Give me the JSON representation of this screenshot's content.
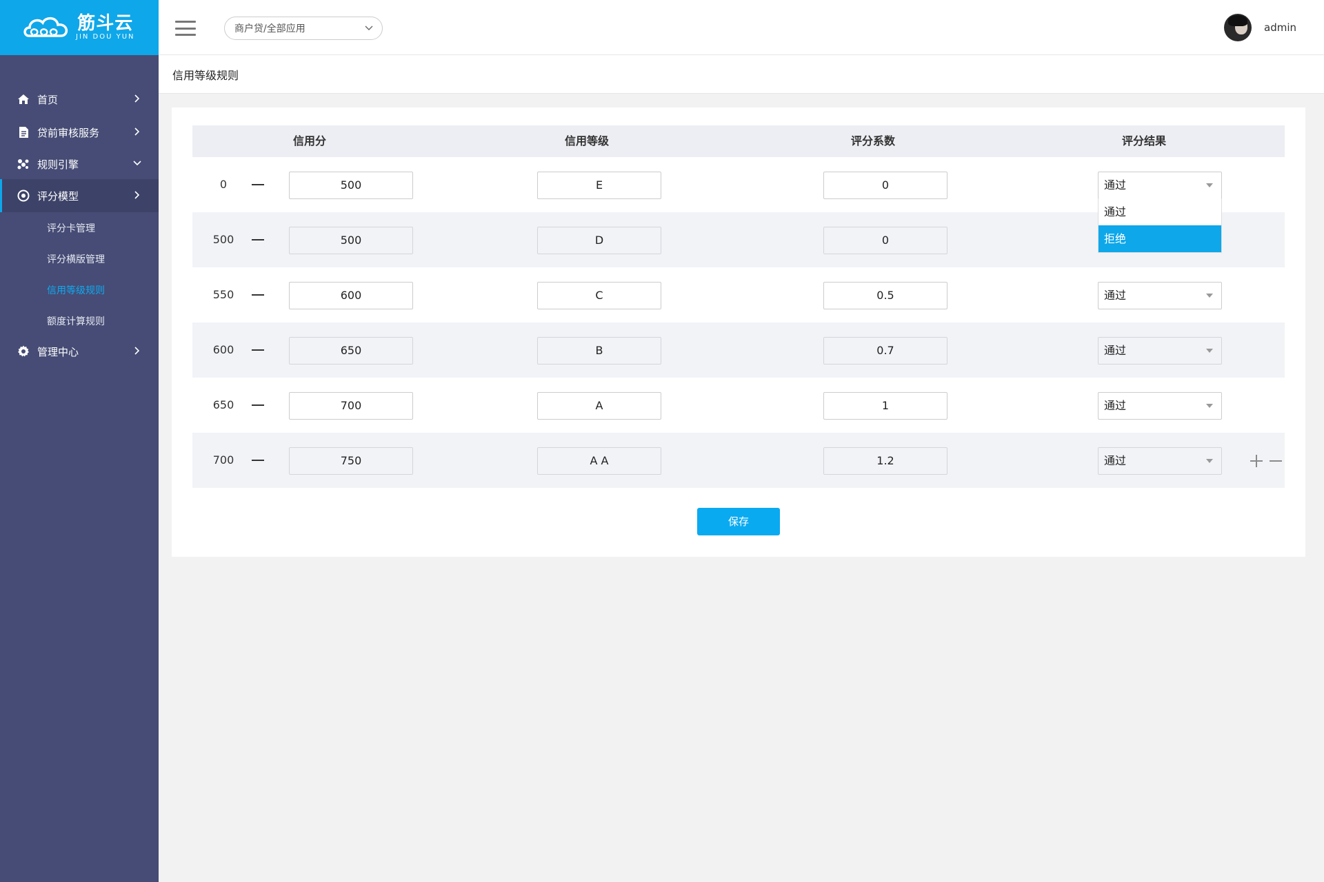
{
  "logo": {
    "cn": "筋斗云",
    "en": "JIN DOU YUN"
  },
  "sidebar": {
    "items": [
      {
        "label": "首页",
        "icon": "home-icon"
      },
      {
        "label": "贷前审核服务",
        "icon": "document-icon"
      },
      {
        "label": "规则引擎",
        "icon": "rules-engine-icon"
      },
      {
        "label": "评分模型",
        "icon": "target-icon"
      }
    ],
    "sub_items": [
      {
        "label": "评分卡管理"
      },
      {
        "label": "评分横版管理"
      },
      {
        "label": "信用等级规则"
      },
      {
        "label": "额度计算规则"
      }
    ],
    "admin_item": {
      "label": "管理中心",
      "icon": "gear-icon"
    }
  },
  "header": {
    "app_select": "商户贷/全部应用",
    "username": "admin"
  },
  "page": {
    "title": "信用等级规则"
  },
  "table": {
    "headers": [
      "信用分",
      "信用等级",
      "评分系数",
      "评分结果"
    ],
    "rows": [
      {
        "lo": "0",
        "hi": "500",
        "grade": "E",
        "coef": "0",
        "result": "通过"
      },
      {
        "lo": "500",
        "hi": "500",
        "grade": "D",
        "coef": "0",
        "result": "通过"
      },
      {
        "lo": "550",
        "hi": "600",
        "grade": "C",
        "coef": "0.5",
        "result": "通过"
      },
      {
        "lo": "600",
        "hi": "650",
        "grade": "B",
        "coef": "0.7",
        "result": "通过"
      },
      {
        "lo": "650",
        "hi": "700",
        "grade": "A",
        "coef": "1",
        "result": "通过"
      },
      {
        "lo": "700",
        "hi": "750",
        "grade": "A A",
        "coef": "1.2",
        "result": "通过"
      }
    ]
  },
  "dropdown": {
    "options": [
      "通过",
      "拒绝"
    ],
    "highlighted": "拒绝"
  },
  "actions": {
    "save_label": "保存"
  },
  "colors": {
    "accent": "#0ea7ea",
    "sidebar_bg": "#464c75",
    "sub_active": "#10a9ef"
  }
}
